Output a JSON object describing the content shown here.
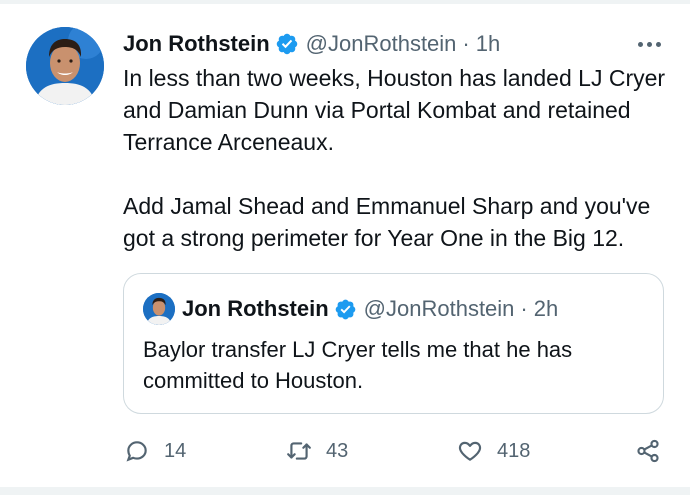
{
  "tweet": {
    "author_name": "Jon Rothstein",
    "handle": "@JonRothstein",
    "separator": "·",
    "time": "1h",
    "paragraphs": [
      "In less than two weeks, Houston has landed LJ Cryer and Damian Dunn via Portal Kombat and retained Terrance Arceneaux.",
      "Add Jamal Shead and Emmanuel Sharp and you've got a strong perimeter for Year One in the Big 12."
    ]
  },
  "quoted_tweet": {
    "author_name": "Jon Rothstein",
    "handle": "@JonRothstein",
    "separator": "·",
    "time": "2h",
    "text": "Baylor transfer LJ Cryer tells me that he has committed to Houston."
  },
  "actions": {
    "replies": "14",
    "retweets": "43",
    "likes": "418"
  },
  "icons": {
    "verified": "verified-badge-icon",
    "more": "more-icon",
    "reply": "reply-icon",
    "retweet": "retweet-icon",
    "like": "heart-icon",
    "share": "share-icon"
  },
  "colors": {
    "verified_blue": "#1d9bf0",
    "secondary_text": "#536471",
    "primary_text": "#0f1419",
    "border": "#cfd9de"
  }
}
